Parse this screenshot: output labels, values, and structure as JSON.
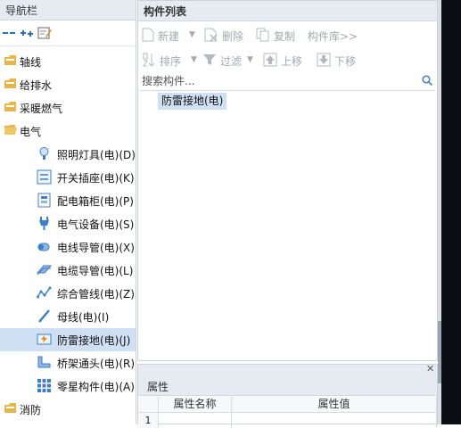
{
  "nav": {
    "title": "导航栏",
    "toolbar_icons": [
      "collapse-all-icon",
      "expand-all-icon",
      "edit-icon"
    ],
    "tree": [
      {
        "type": "folder",
        "label": "轴线"
      },
      {
        "type": "folder",
        "label": "给排水"
      },
      {
        "type": "folder",
        "label": "采暖燃气"
      },
      {
        "type": "folder-open",
        "label": "电气"
      },
      {
        "type": "item",
        "label": "照明灯具(电)(D)",
        "icon": "lamp-icon"
      },
      {
        "type": "item",
        "label": "开关插座(电)(K)",
        "icon": "switch-socket-icon"
      },
      {
        "type": "item",
        "label": "配电箱柜(电)(P)",
        "icon": "distribution-box-icon"
      },
      {
        "type": "item",
        "label": "电气设备(电)(S)",
        "icon": "electrical-equipment-icon"
      },
      {
        "type": "item",
        "label": "电线导管(电)(X)",
        "icon": "wire-conduit-icon"
      },
      {
        "type": "item",
        "label": "电缆导管(电)(L)",
        "icon": "cable-conduit-icon"
      },
      {
        "type": "item",
        "label": "综合管线(电)(Z)",
        "icon": "composite-pipeline-icon"
      },
      {
        "type": "item",
        "label": "母线(电)(I)",
        "icon": "busbar-icon"
      },
      {
        "type": "item",
        "label": "防雷接地(电)(J)",
        "icon": "lightning-grounding-icon",
        "selected": true
      },
      {
        "type": "item",
        "label": "桥架通头(电)(R)",
        "icon": "tray-fitting-icon"
      },
      {
        "type": "item",
        "label": "零星构件(电)(A)",
        "icon": "misc-component-icon"
      },
      {
        "type": "folder",
        "label": "消防"
      }
    ]
  },
  "components": {
    "title": "构件列表",
    "toolbar_row1": {
      "new": "新建",
      "delete": "删除",
      "copy": "复制",
      "library": "构件库>>"
    },
    "toolbar_row2": {
      "sort": "排序",
      "filter": "过滤",
      "move_up": "上移",
      "move_down": "下移"
    },
    "search_placeholder": "搜索构件...",
    "items": [
      "防雷接地(电)"
    ]
  },
  "properties": {
    "title": "属性",
    "columns": [
      "属性名称",
      "属性值"
    ],
    "first_row_number": "1"
  },
  "colors": {
    "selection": "#cfe0f5",
    "header_bg": "#e6ebf1",
    "folder": "#e8b54a",
    "icon_blue": "#3b7fc9"
  }
}
